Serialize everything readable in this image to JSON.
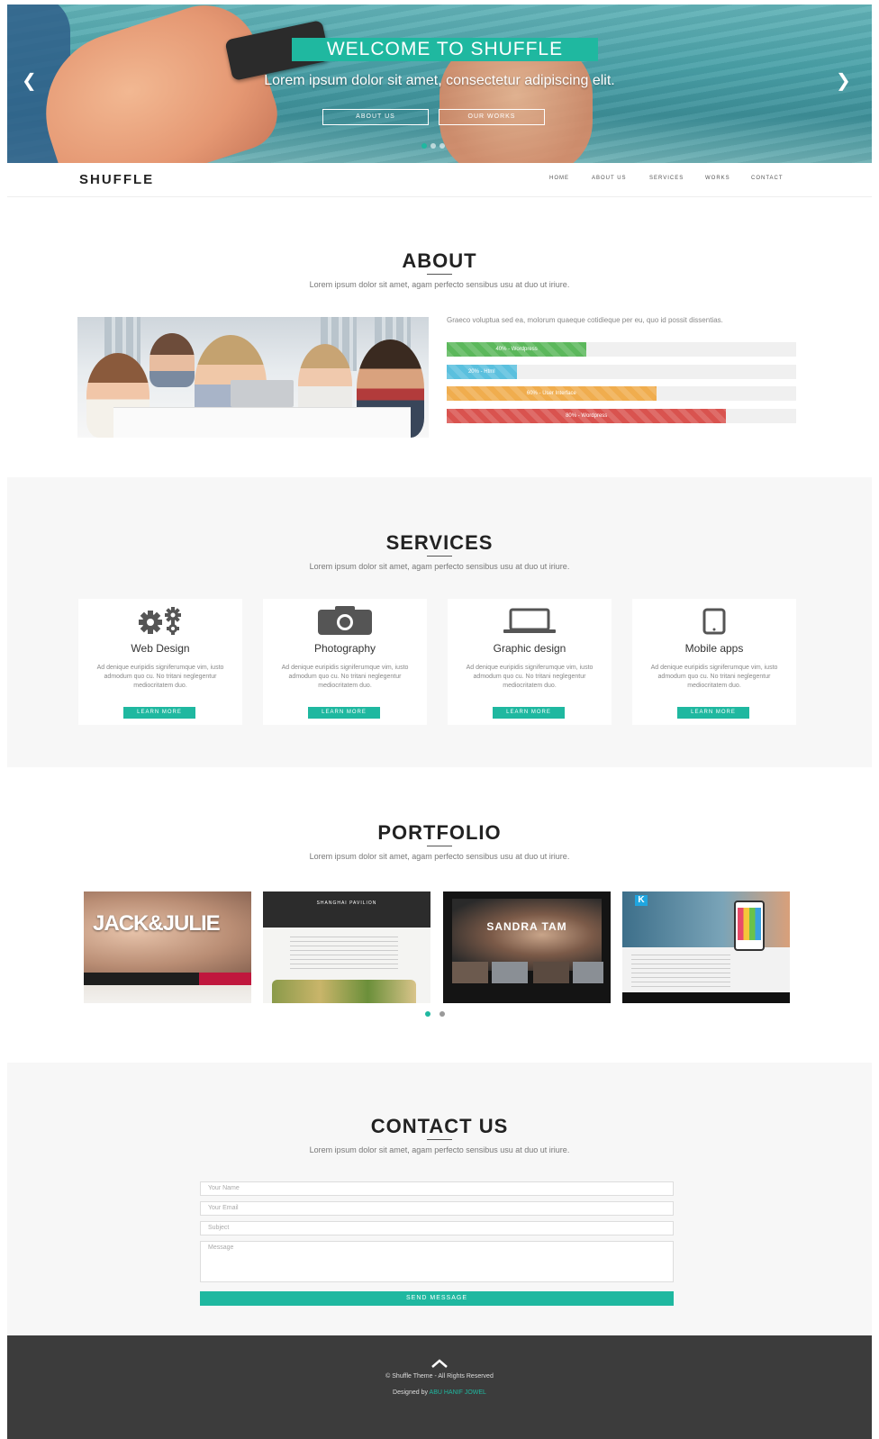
{
  "hero": {
    "title": "WELCOME TO SHUFFLE",
    "subtitle": "Lorem ipsum dolor sit amet, consectetur adipiscing elit.",
    "buttons": [
      "ABOUT US",
      "OUR WORKS"
    ],
    "prev_icon": "chevron-left-icon",
    "next_icon": "chevron-right-icon"
  },
  "nav": {
    "brand": "SHUFFLE",
    "items": [
      "HOME",
      "ABOUT US",
      "SERVICES",
      "WORKS",
      "CONTACT"
    ]
  },
  "about": {
    "title": "ABOUT",
    "subtitle": "Lorem ipsum dolor sit amet, agam perfecto sensibus usu at duo ut iriure.",
    "text": "Graeco voluptua sed ea, molorum quaeque cotidieque per eu, quo id possit dissentias.",
    "skills": [
      {
        "label": "40% - Wordpress",
        "percent": 40,
        "color": "#5cb85c"
      },
      {
        "label": "20% - Html",
        "percent": 20,
        "color": "#5bc0de"
      },
      {
        "label": "60% - User Interface",
        "percent": 60,
        "color": "#f0ad4e"
      },
      {
        "label": "80% - Wordpress",
        "percent": 80,
        "color": "#d9534f"
      }
    ]
  },
  "services": {
    "title": "SERVICES",
    "subtitle": "Lorem ipsum dolor sit amet, agam perfecto sensibus usu at duo ut iriure.",
    "items": [
      {
        "icon": "gears-icon",
        "title": "Web Design",
        "desc": "Ad denique euripidis signiferumque vim, iusto admodum quo cu. No tritani neglegentur mediocritatem duo.",
        "button": "LEARN MORE"
      },
      {
        "icon": "camera-icon",
        "title": "Photography",
        "desc": "Ad denique euripidis signiferumque vim, iusto admodum quo cu. No tritani neglegentur mediocritatem duo.",
        "button": "LEARN MORE"
      },
      {
        "icon": "laptop-icon",
        "title": "Graphic design",
        "desc": "Ad denique euripidis signiferumque vim, iusto admodum quo cu. No tritani neglegentur mediocritatem duo.",
        "button": "LEARN MORE"
      },
      {
        "icon": "tablet-icon",
        "title": "Mobile apps",
        "desc": "Ad denique euripidis signiferumque vim, iusto admodum quo cu. No tritani neglegentur mediocritatem duo.",
        "button": "LEARN MORE"
      }
    ]
  },
  "portfolio": {
    "title": "PORTFOLIO",
    "subtitle": "Lorem ipsum dolor sit amet, agam perfecto sensibus usu at duo ut iriure.",
    "items": [
      {
        "caption": "JACK&JULIE"
      },
      {
        "caption": "SHANGHAI PAVILION"
      },
      {
        "caption": "SANDRA TAM"
      },
      {
        "caption": "K"
      }
    ]
  },
  "contact": {
    "title": "CONTACT US",
    "subtitle": "Lorem ipsum dolor sit amet, agam perfecto sensibus usu at duo ut iriure.",
    "name_placeholder": "Your Name",
    "email_placeholder": "Your Email",
    "subject_placeholder": "Subject",
    "message_placeholder": "Message",
    "send_label": "SEND MESSAGE"
  },
  "footer": {
    "up_icon": "chevron-up-icon",
    "copyright": "© Shuffle Theme - All Rights Reserved",
    "designed_by": "Designed by",
    "designer": "ABU HANIF JOWEL"
  }
}
